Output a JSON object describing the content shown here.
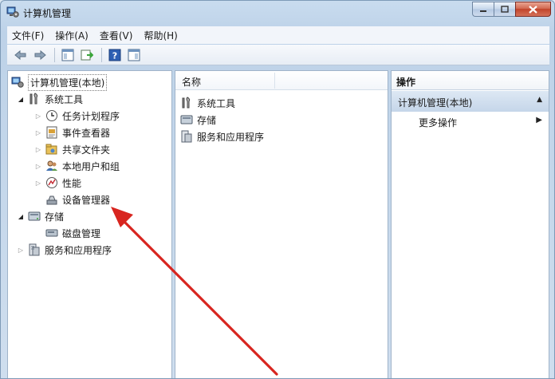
{
  "window": {
    "title": "计算机管理"
  },
  "menu": [
    "文件(F)",
    "操作(A)",
    "查看(V)",
    "帮助(H)"
  ],
  "toolbar": {
    "buttons": [
      "back-arrow-icon",
      "forward-arrow-icon",
      "show-hide-tree-icon",
      "export-list-icon",
      "help-icon",
      "properties-icon"
    ]
  },
  "tree": {
    "root": "计算机管理(本地)",
    "system_tools": "系统工具",
    "task_scheduler": "任务计划程序",
    "event_viewer": "事件查看器",
    "shared_folders": "共享文件夹",
    "local_users": "本地用户和组",
    "performance": "性能",
    "device_manager": "设备管理器",
    "storage": "存储",
    "disk_management": "磁盘管理",
    "services_apps": "服务和应用程序"
  },
  "center": {
    "column_name": "名称",
    "items": [
      "系统工具",
      "存储",
      "服务和应用程序"
    ]
  },
  "actions": {
    "header": "操作",
    "section": "计算机管理(本地)",
    "more": "更多操作"
  },
  "colors": {
    "annotation_arrow": "#d8251f",
    "selection_bar": "#c5d6e9"
  }
}
